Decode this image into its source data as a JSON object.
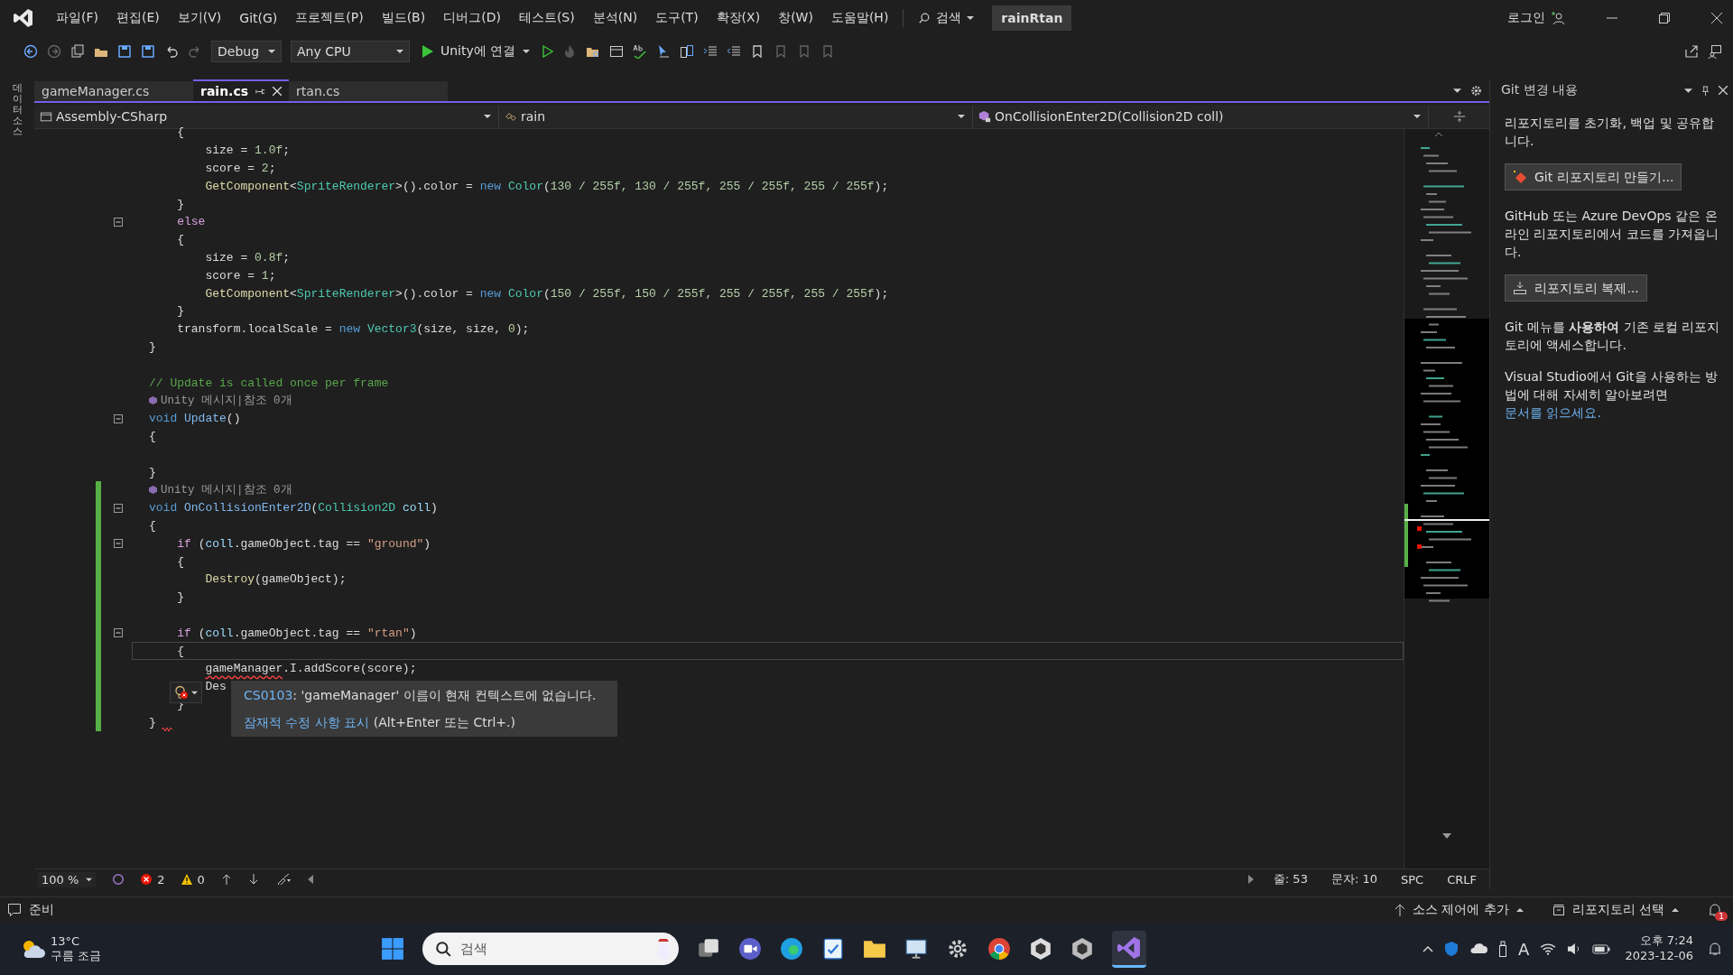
{
  "menu": [
    "파일(F)",
    "편집(E)",
    "보기(V)",
    "Git(G)",
    "프로젝트(P)",
    "빌드(B)",
    "디버그(D)",
    "테스트(S)",
    "분석(N)",
    "도구(T)",
    "확장(X)",
    "창(W)",
    "도움말(H)"
  ],
  "search": {
    "label": "검색"
  },
  "solution_name": "rainRtan",
  "login": "로그인",
  "toolbar": {
    "configuration": "Debug",
    "platform": "Any CPU",
    "run_label": "Unity에 연결"
  },
  "side_tab": "데이터 소스",
  "tabs": [
    {
      "label": "gameManager.cs",
      "selected": false
    },
    {
      "label": "rain.cs",
      "selected": true
    },
    {
      "label": "rtan.cs",
      "selected": false
    }
  ],
  "nav": {
    "project": "Assembly-CSharp",
    "type": "rain",
    "member": "OnCollisionEnter2D(Collision2D coll)"
  },
  "code_lines": [
    {
      "kind": "code",
      "fold": false,
      "changed": false,
      "current": false,
      "tokens": [
        {
          "t": "    {",
          "kind": "plain"
        }
      ]
    },
    {
      "kind": "code",
      "fold": false,
      "changed": false,
      "current": false,
      "tokens": [
        {
          "t": "        size = ",
          "kind": "plain"
        },
        {
          "t": "1.0f",
          "kind": "num"
        },
        {
          "t": ";",
          "kind": "plain"
        }
      ]
    },
    {
      "kind": "code",
      "fold": false,
      "changed": false,
      "current": false,
      "tokens": [
        {
          "t": "        score = ",
          "kind": "plain"
        },
        {
          "t": "2",
          "kind": "num"
        },
        {
          "t": ";",
          "kind": "plain"
        }
      ]
    },
    {
      "kind": "code",
      "fold": false,
      "changed": false,
      "current": false,
      "tokens": [
        {
          "t": "        GetComponent",
          "kind": "fn"
        },
        {
          "t": "<",
          "kind": "plain"
        },
        {
          "t": "SpriteRenderer",
          "kind": "type"
        },
        {
          "t": ">().color = ",
          "kind": "plain"
        },
        {
          "t": "new ",
          "kind": "kw"
        },
        {
          "t": "Color",
          "kind": "type"
        },
        {
          "t": "(",
          "kind": "plain"
        },
        {
          "t": "130 / 255f, 130 / 255f, 255 / 255f, 255 / 255f",
          "kind": "num"
        },
        {
          "t": ");",
          "kind": "plain"
        }
      ]
    },
    {
      "kind": "code",
      "fold": false,
      "changed": false,
      "current": false,
      "tokens": [
        {
          "t": "    }",
          "kind": "plain"
        }
      ]
    },
    {
      "kind": "code",
      "fold": true,
      "changed": false,
      "current": false,
      "tokens": [
        {
          "t": "    else",
          "kind": "ctl"
        }
      ]
    },
    {
      "kind": "code",
      "fold": false,
      "changed": false,
      "current": false,
      "tokens": [
        {
          "t": "    {",
          "kind": "plain"
        }
      ]
    },
    {
      "kind": "code",
      "fold": false,
      "changed": false,
      "current": false,
      "tokens": [
        {
          "t": "        size = ",
          "kind": "plain"
        },
        {
          "t": "0.8f",
          "kind": "num"
        },
        {
          "t": ";",
          "kind": "plain"
        }
      ]
    },
    {
      "kind": "code",
      "fold": false,
      "changed": false,
      "current": false,
      "tokens": [
        {
          "t": "        score = ",
          "kind": "plain"
        },
        {
          "t": "1",
          "kind": "num"
        },
        {
          "t": ";",
          "kind": "plain"
        }
      ]
    },
    {
      "kind": "code",
      "fold": false,
      "changed": false,
      "current": false,
      "tokens": [
        {
          "t": "        GetComponent",
          "kind": "fn"
        },
        {
          "t": "<",
          "kind": "plain"
        },
        {
          "t": "SpriteRenderer",
          "kind": "type"
        },
        {
          "t": ">().color = ",
          "kind": "plain"
        },
        {
          "t": "new ",
          "kind": "kw"
        },
        {
          "t": "Color",
          "kind": "type"
        },
        {
          "t": "(",
          "kind": "plain"
        },
        {
          "t": "150 / 255f, 150 / 255f, 255 / 255f, 255 / 255f",
          "kind": "num"
        },
        {
          "t": ");",
          "kind": "plain"
        }
      ]
    },
    {
      "kind": "code",
      "fold": false,
      "changed": false,
      "current": false,
      "tokens": [
        {
          "t": "    }",
          "kind": "plain"
        }
      ]
    },
    {
      "kind": "code",
      "fold": false,
      "changed": false,
      "current": false,
      "tokens": [
        {
          "t": "    transform.localScale = ",
          "kind": "plain"
        },
        {
          "t": "new ",
          "kind": "kw"
        },
        {
          "t": "Vector3",
          "kind": "type"
        },
        {
          "t": "(size, size, ",
          "kind": "plain"
        },
        {
          "t": "0",
          "kind": "num"
        },
        {
          "t": ");",
          "kind": "plain"
        }
      ]
    },
    {
      "kind": "code",
      "fold": false,
      "changed": false,
      "current": false,
      "tokens": [
        {
          "t": "}",
          "kind": "plain"
        }
      ]
    },
    {
      "kind": "blank",
      "fold": false,
      "changed": false,
      "current": false
    },
    {
      "kind": "code",
      "fold": false,
      "changed": false,
      "current": false,
      "tokens": [
        {
          "t": "// Update is called once per frame",
          "kind": "cmt"
        }
      ]
    },
    {
      "kind": "lens",
      "fold": false,
      "changed": false,
      "current": false,
      "text": "Unity 메시지|참조 0개"
    },
    {
      "kind": "code",
      "fold": true,
      "changed": false,
      "current": false,
      "tokens": [
        {
          "t": "void ",
          "kind": "kw"
        },
        {
          "t": "Update",
          "kind": "decl"
        },
        {
          "t": "()",
          "kind": "plain"
        }
      ]
    },
    {
      "kind": "code",
      "fold": false,
      "changed": false,
      "current": false,
      "tokens": [
        {
          "t": "{",
          "kind": "plain"
        }
      ]
    },
    {
      "kind": "blank",
      "fold": false,
      "changed": false,
      "current": false
    },
    {
      "kind": "code",
      "fold": false,
      "changed": false,
      "current": false,
      "tokens": [
        {
          "t": "}",
          "kind": "plain"
        }
      ]
    },
    {
      "kind": "lens",
      "fold": false,
      "changed": true,
      "current": false,
      "text": "Unity 메시지|참조 0개"
    },
    {
      "kind": "code",
      "fold": true,
      "changed": true,
      "current": false,
      "tokens": [
        {
          "t": "void ",
          "kind": "kw"
        },
        {
          "t": "OnCollisionEnter2D",
          "kind": "decl"
        },
        {
          "t": "(",
          "kind": "plain"
        },
        {
          "t": "Collision2D ",
          "kind": "type"
        },
        {
          "t": "coll",
          "kind": "param"
        },
        {
          "t": ")",
          "kind": "plain"
        }
      ]
    },
    {
      "kind": "code",
      "fold": false,
      "changed": true,
      "current": false,
      "tokens": [
        {
          "t": "{",
          "kind": "plain"
        }
      ]
    },
    {
      "kind": "code",
      "fold": true,
      "changed": true,
      "current": false,
      "tokens": [
        {
          "t": "    if",
          "kind": "ctl"
        },
        {
          "t": " (",
          "kind": "plain"
        },
        {
          "t": "coll",
          "kind": "param"
        },
        {
          "t": ".gameObject.tag == ",
          "kind": "plain"
        },
        {
          "t": "\"ground\"",
          "kind": "str"
        },
        {
          "t": ")",
          "kind": "plain"
        }
      ]
    },
    {
      "kind": "code",
      "fold": false,
      "changed": true,
      "current": false,
      "tokens": [
        {
          "t": "    {",
          "kind": "plain"
        }
      ]
    },
    {
      "kind": "code",
      "fold": false,
      "changed": true,
      "current": false,
      "tokens": [
        {
          "t": "        Destroy",
          "kind": "fn"
        },
        {
          "t": "(gameObject);",
          "kind": "plain"
        }
      ]
    },
    {
      "kind": "code",
      "fold": false,
      "changed": true,
      "current": false,
      "tokens": [
        {
          "t": "    }",
          "kind": "plain"
        }
      ]
    },
    {
      "kind": "blank",
      "fold": false,
      "changed": true,
      "current": false
    },
    {
      "kind": "code",
      "fold": true,
      "changed": true,
      "current": false,
      "tokens": [
        {
          "t": "    if",
          "kind": "ctl"
        },
        {
          "t": " (",
          "kind": "plain"
        },
        {
          "t": "coll",
          "kind": "param"
        },
        {
          "t": ".gameObject.tag == ",
          "kind": "plain"
        },
        {
          "t": "\"rtan\"",
          "kind": "str"
        },
        {
          "t": ")",
          "kind": "plain"
        }
      ]
    },
    {
      "kind": "code",
      "fold": false,
      "changed": true,
      "current": true,
      "tokens": [
        {
          "t": "    {",
          "kind": "plain"
        }
      ]
    },
    {
      "kind": "code",
      "fold": false,
      "changed": true,
      "current": false,
      "tokens": [
        {
          "t": "        gameManager",
          "kind": "err"
        },
        {
          "t": ".I.addScore(score);",
          "kind": "plain"
        }
      ]
    },
    {
      "kind": "code",
      "fold": false,
      "changed": true,
      "current": false,
      "tokens": [
        {
          "t": "        Des",
          "kind": "plain"
        }
      ]
    },
    {
      "kind": "code",
      "fold": false,
      "changed": true,
      "current": false,
      "tokens": [
        {
          "t": "    }",
          "kind": "plain"
        }
      ]
    },
    {
      "kind": "code",
      "fold": false,
      "changed": true,
      "current": false,
      "tokens": [
        {
          "t": "}",
          "kind": "plain"
        }
      ]
    }
  ],
  "tooltip": {
    "code": "CS0103",
    "message": ": 'gameManager' 이름이 현재 컨텍스트에 없습니다.",
    "fix_link": "잠재적 수정 사항 표시",
    "shortcut": "(Alt+Enter 또는 Ctrl+.)"
  },
  "editor_status": {
    "zoom": "100 %",
    "errors": "2",
    "warnings": "0",
    "line": "줄: 53",
    "column": "문자: 10",
    "whitespace": "SPC",
    "line_ending": "CRLF"
  },
  "git_panel": {
    "title": "Git 변경 내용",
    "intro": "리포지토리를 초기화, 백업 및 공유합니다.",
    "create_button": "Git 리포지토리 만들기...",
    "remote_text": "GitHub 또는 Azure DevOps 같은 온라인 리포지토리에서 코드를 가져옵니다.",
    "clone_button": "리포지토리 복제...",
    "local_text": "Git 메뉴를 **사용하여** 기존 로컬 리포지토리에 액세스합니다.",
    "docs_text": "Visual Studio에서 Git을 사용하는 방법에 대해 자세히 알아보려면",
    "docs_link": "문서를 읽으세요."
  },
  "status_bar": {
    "state": "준비",
    "add_source_control": "소스 제어에 추가",
    "select_repo": "리포지토리 선택",
    "notifications": "1"
  },
  "taskbar": {
    "temperature": "13°C",
    "weather": "구름 조금",
    "search": "검색",
    "ime": "A",
    "time": "오후 7:24",
    "date": "2023-12-06"
  }
}
